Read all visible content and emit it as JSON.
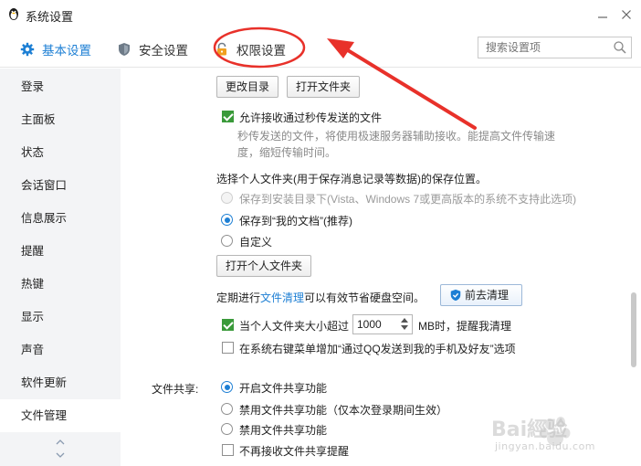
{
  "window": {
    "title": "系统设置"
  },
  "tabs": [
    {
      "label": "基本设置",
      "icon": "gear-icon",
      "active": true
    },
    {
      "label": "安全设置",
      "icon": "shield-icon",
      "active": false
    },
    {
      "label": "权限设置",
      "icon": "lock-icon",
      "active": false
    }
  ],
  "search": {
    "placeholder": "搜索设置项"
  },
  "sidebar": {
    "items": [
      {
        "label": "登录"
      },
      {
        "label": "主面板"
      },
      {
        "label": "状态"
      },
      {
        "label": "会话窗口"
      },
      {
        "label": "信息展示"
      },
      {
        "label": "提醒"
      },
      {
        "label": "热键"
      },
      {
        "label": "显示"
      },
      {
        "label": "声音"
      },
      {
        "label": "软件更新"
      },
      {
        "label": "文件管理",
        "active": true
      }
    ]
  },
  "content": {
    "change_dir_button": "更改目录",
    "open_folder_button": "打开文件夹",
    "allow_instant_label": "允许接收通过秒传发送的文件",
    "allow_instant_desc_1": "秒传发送的文件，将使用极速服务器辅助接收。能提高文件传输速",
    "allow_instant_desc_2": "度，缩短传输时间。",
    "select_folder_heading": "选择个人文件夹(用于保存消息记录等数据)的保存位置。",
    "radio_install_dir": "保存到安装目录下(Vista、Windows 7或更高版本的系统不支持此选项)",
    "radio_my_docs": "保存到“我的文档”(推荐)",
    "radio_custom": "自定义",
    "open_personal_folder_button": "打开个人文件夹",
    "cleanup_prefix": "定期进行",
    "cleanup_link": "文件清理",
    "cleanup_suffix": "可以有效节省硬盘空间。",
    "cleanup_button": "前去清理",
    "size_limit_prefix": "当个人文件夹大小超过",
    "size_limit_value": "1000",
    "size_limit_suffix": "MB时，提醒我清理",
    "context_menu_label": "在系统右键菜单增加“通过QQ发送到我的手机及好友”选项",
    "file_share_label": "文件共享:",
    "share_enable": "开启文件共享功能",
    "share_disable_session": "禁用文件共享功能（仅本次登录期间生效）",
    "share_disable": "禁用文件共享功能",
    "share_no_prompt": "不再接收文件共享提醒"
  },
  "watermark": {
    "brand": "Bai經验",
    "sub": "jingyan.baidu.com"
  },
  "colors": {
    "accent": "#1d7fd4",
    "annotation": "#e8312a",
    "check": "#3a9a3a"
  }
}
